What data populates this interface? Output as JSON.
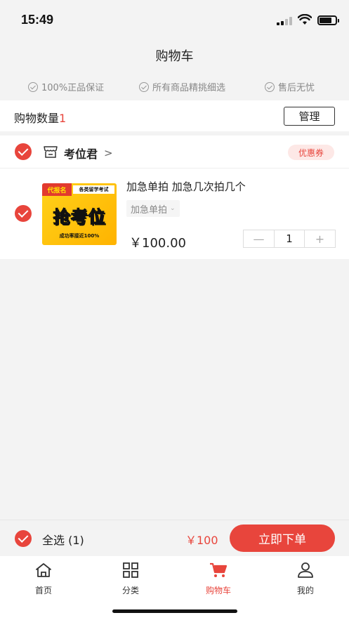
{
  "status_bar": {
    "time": "15:49"
  },
  "header": {
    "title": "购物车"
  },
  "guarantees": [
    "100%正品保证",
    "所有商品精挑细选",
    "售后无忧"
  ],
  "cart_summary": {
    "label": "购物数量",
    "count": "1",
    "manage_label": "管理"
  },
  "shop": {
    "name": "考位君",
    "arrow": ">",
    "coupon_label": "优惠券",
    "item": {
      "title": "加急单拍 加急几次拍几个",
      "variant": "加急单拍",
      "price": "￥100.00",
      "quantity": "1",
      "image": {
        "tag": "代报名",
        "subtitle": "各类留学考试",
        "headline": "抢考位",
        "footer": "成功率接近100%"
      }
    }
  },
  "checkout": {
    "select_all_label": "全选 (1)",
    "total": "￥100",
    "order_button": "立即下单"
  },
  "tabbar": {
    "items": [
      {
        "label": "首页",
        "icon": "home-icon"
      },
      {
        "label": "分类",
        "icon": "grid-icon"
      },
      {
        "label": "购物车",
        "icon": "cart-icon"
      },
      {
        "label": "我的",
        "icon": "user-icon"
      }
    ],
    "active": "购物车"
  },
  "colors": {
    "accent": "#e8453c",
    "background": "#f3f3f3"
  }
}
